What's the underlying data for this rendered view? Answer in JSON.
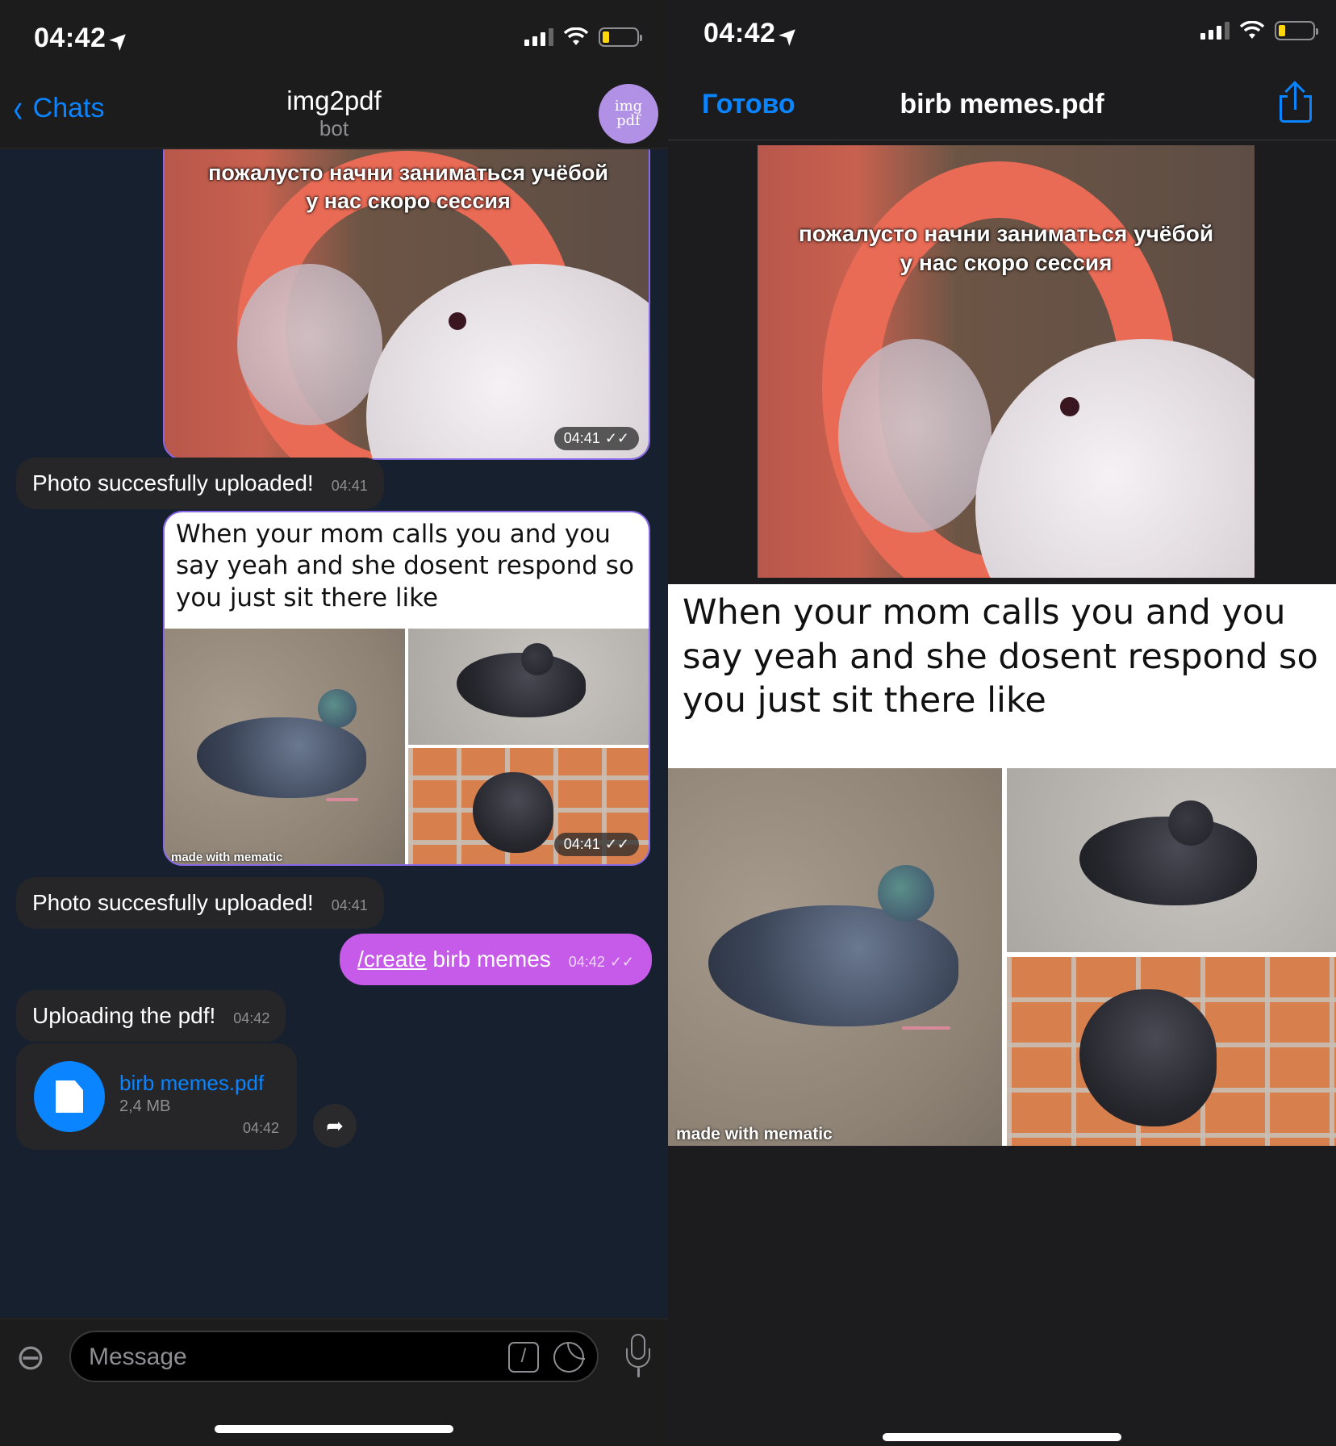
{
  "status_bar": {
    "time": "04:42"
  },
  "chat": {
    "back_label": "Chats",
    "title": "img2pdf",
    "subtitle": "bot",
    "avatar_text": "img pdf",
    "messages": {
      "photo1_caption": "пожалусто начни заниматься учёбой\nу нас скоро сессия",
      "photo1_time": "04:41",
      "reply1_text": "Photo succesfully uploaded!",
      "reply1_time": "04:41",
      "photo2_text": "When your mom calls you and you say yeah and she dosent respond so you just sit there like",
      "photo2_watermark": "made with mematic",
      "photo2_time": "04:41",
      "reply2_text": "Photo succesfully uploaded!",
      "reply2_time": "04:41",
      "command": "/create",
      "command_rest": " birb memes",
      "command_time": "04:42",
      "uploading_text": "Uploading the pdf!",
      "uploading_time": "04:42",
      "file_name": "birb memes.pdf",
      "file_size": "2,4 MB",
      "file_time": "04:42"
    },
    "input_placeholder": "Message"
  },
  "pdf_viewer": {
    "done_label": "Готово",
    "title": "birb memes.pdf",
    "page1_caption": "пожалусто начни заниматься учёбой\nу нас скоро сессия",
    "page2_text": "When your mom calls you and you say yeah and she dosent respond so you just sit there like",
    "page2_watermark": "made with mematic"
  },
  "colors": {
    "accent": "#0a84ff",
    "outgoing_bubble": "#c55be8",
    "photo_border": "#8a69e8",
    "incoming_bubble": "#262628"
  }
}
